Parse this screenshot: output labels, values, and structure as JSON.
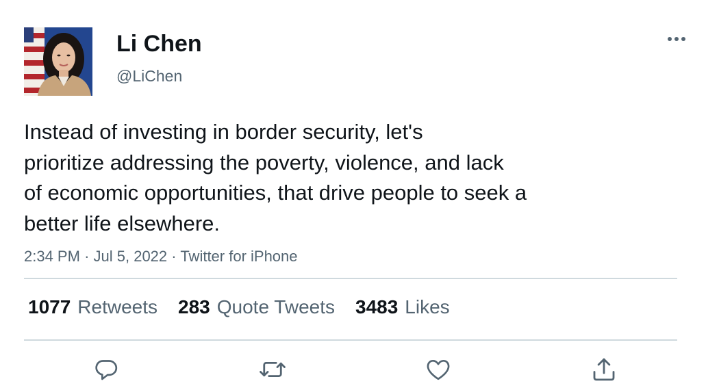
{
  "author": {
    "display_name": "Li Chen",
    "handle": "@LiChen"
  },
  "tweet": {
    "text": "Instead of investing in border security, let's\nprioritize addressing the poverty, violence, and lack\nof economic opportunities, that drive people to seek a\nbetter life elsewhere.",
    "time": "2:34 PM",
    "date": "Jul 5, 2022",
    "source": "Twitter for iPhone",
    "separator": "·"
  },
  "stats": {
    "retweets": {
      "count": "1077",
      "label": "Retweets"
    },
    "quotes": {
      "count": "283",
      "label": "Quote Tweets"
    },
    "likes": {
      "count": "3483",
      "label": "Likes"
    }
  },
  "icons": {
    "more": "more-horizontal-icon",
    "reply": "reply-icon",
    "retweet": "retweet-icon",
    "like": "heart-icon",
    "share": "share-icon"
  },
  "colors": {
    "text_primary": "#0f1419",
    "text_secondary": "#536471",
    "divider": "#cfd9de",
    "icon": "#536471"
  }
}
